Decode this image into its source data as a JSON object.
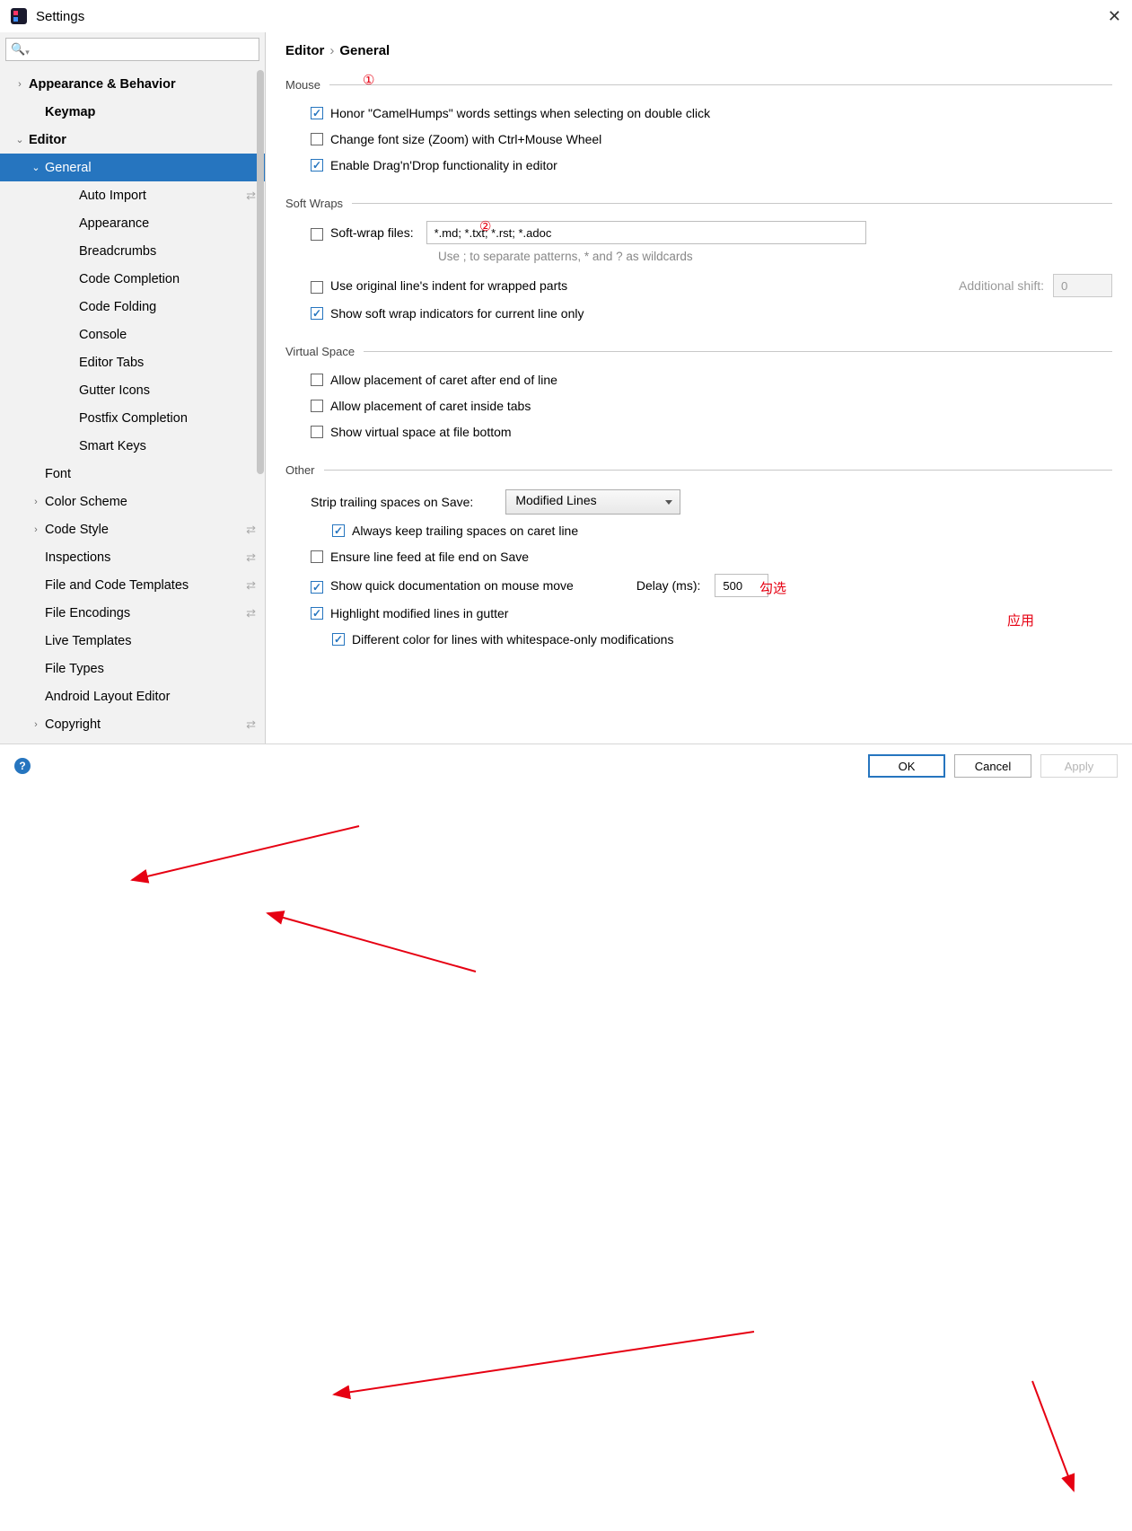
{
  "window": {
    "title": "Settings"
  },
  "breadcrumb": {
    "a": "Editor",
    "b": "General"
  },
  "sidebar": {
    "search_placeholder": "",
    "items": [
      {
        "label": "Appearance & Behavior",
        "lvl": 0,
        "chev": "›",
        "bold": true
      },
      {
        "label": "Keymap",
        "lvl": 1,
        "chev": "",
        "bold": true
      },
      {
        "label": "Editor",
        "lvl": 0,
        "chev": "⌄",
        "bold": true
      },
      {
        "label": "General",
        "lvl": 1,
        "chev": "⌄",
        "bold": false,
        "sel": true
      },
      {
        "label": "Auto Import",
        "lvl": 3,
        "linked": true
      },
      {
        "label": "Appearance",
        "lvl": 3
      },
      {
        "label": "Breadcrumbs",
        "lvl": 3
      },
      {
        "label": "Code Completion",
        "lvl": 3
      },
      {
        "label": "Code Folding",
        "lvl": 3
      },
      {
        "label": "Console",
        "lvl": 3
      },
      {
        "label": "Editor Tabs",
        "lvl": 3
      },
      {
        "label": "Gutter Icons",
        "lvl": 3
      },
      {
        "label": "Postfix Completion",
        "lvl": 3
      },
      {
        "label": "Smart Keys",
        "lvl": 3
      },
      {
        "label": "Font",
        "lvl": 1
      },
      {
        "label": "Color Scheme",
        "lvl": 1,
        "chev": "›"
      },
      {
        "label": "Code Style",
        "lvl": 1,
        "chev": "›",
        "linked": true
      },
      {
        "label": "Inspections",
        "lvl": 1,
        "linked": true
      },
      {
        "label": "File and Code Templates",
        "lvl": 1,
        "linked": true
      },
      {
        "label": "File Encodings",
        "lvl": 1,
        "linked": true
      },
      {
        "label": "Live Templates",
        "lvl": 1
      },
      {
        "label": "File Types",
        "lvl": 1
      },
      {
        "label": "Android Layout Editor",
        "lvl": 1
      },
      {
        "label": "Copyright",
        "lvl": 1,
        "chev": "›",
        "linked": true
      }
    ]
  },
  "sections": {
    "mouse": {
      "title": "Mouse",
      "opt1": "Honor \"CamelHumps\" words settings when selecting on double click",
      "opt2": "Change font size (Zoom) with Ctrl+Mouse Wheel",
      "opt3": "Enable Drag'n'Drop functionality in editor"
    },
    "softwraps": {
      "title": "Soft Wraps",
      "lbl": "Soft-wrap files:",
      "value": "*.md; *.txt; *.rst; *.adoc",
      "hint": "Use ; to separate patterns, * and ? as wildcards",
      "opt1": "Use original line's indent for wrapped parts",
      "addshift_lbl": "Additional shift:",
      "addshift_val": "0",
      "opt2": "Show soft wrap indicators for current line only"
    },
    "vspace": {
      "title": "Virtual Space",
      "opt1": "Allow placement of caret after end of line",
      "opt2": "Allow placement of caret inside tabs",
      "opt3": "Show virtual space at file bottom"
    },
    "other": {
      "title": "Other",
      "strip_lbl": "Strip trailing spaces on Save:",
      "strip_val": "Modified Lines",
      "opt1": "Always keep trailing spaces on caret line",
      "opt2": "Ensure line feed at file end on Save",
      "opt3": "Show quick documentation on mouse move",
      "delay_lbl": "Delay (ms):",
      "delay_val": "500",
      "opt4": "Highlight modified lines in gutter",
      "opt5": "Different color for lines with whitespace-only modifications"
    }
  },
  "buttons": {
    "ok": "OK",
    "cancel": "Cancel",
    "apply": "Apply"
  },
  "annot": {
    "one": "①",
    "two": "②",
    "gouxuan": "勾选",
    "yingyong": "应用"
  }
}
